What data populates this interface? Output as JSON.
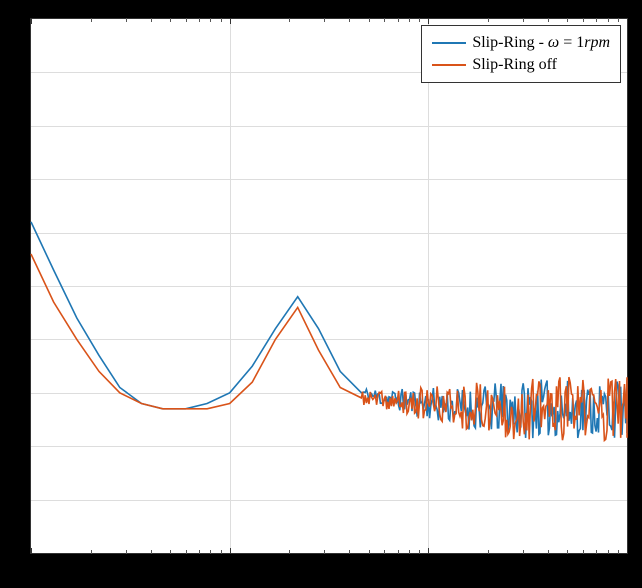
{
  "chart_data": {
    "type": "line",
    "x_scale": "log",
    "xlim": [
      1,
      1000
    ],
    "ylim": [
      0,
      1
    ],
    "grid_major_x": [
      1,
      10,
      100,
      1000
    ],
    "grid_major_y": [
      0,
      0.1,
      0.2,
      0.3,
      0.4,
      0.5,
      0.6,
      0.7,
      0.8,
      0.9,
      1.0
    ],
    "legend": {
      "position": "upper right",
      "entries": [
        {
          "name": "Slip-Ring - ω = 1rpm",
          "color": "#1f77b4"
        },
        {
          "name": "Slip-Ring off",
          "color": "#d95319"
        }
      ]
    },
    "series": [
      {
        "name": "Slip-Ring - ω = 1rpm",
        "color": "#1f77b4",
        "x": [
          1,
          1.3,
          1.7,
          2.2,
          2.8,
          3.6,
          4.6,
          6,
          7.7,
          10,
          13,
          17,
          22,
          28,
          36,
          46,
          60,
          77,
          100,
          130,
          170,
          220,
          280,
          360,
          460,
          600,
          770,
          1000
        ],
        "y": [
          0.62,
          0.53,
          0.44,
          0.37,
          0.31,
          0.28,
          0.27,
          0.27,
          0.28,
          0.3,
          0.35,
          0.42,
          0.48,
          0.42,
          0.34,
          0.3,
          0.29,
          0.285,
          0.28,
          0.275,
          0.27,
          0.27,
          0.27,
          0.27,
          0.27,
          0.27,
          0.27,
          0.27
        ],
        "noise_after_x": 46,
        "noise_amp": 0.055
      },
      {
        "name": "Slip-Ring off",
        "color": "#d95319",
        "x": [
          1,
          1.3,
          1.7,
          2.2,
          2.8,
          3.6,
          4.6,
          6,
          7.7,
          10,
          13,
          17,
          22,
          28,
          36,
          46,
          60,
          77,
          100,
          130,
          170,
          220,
          280,
          360,
          460,
          600,
          770,
          1000
        ],
        "y": [
          0.56,
          0.47,
          0.4,
          0.34,
          0.3,
          0.28,
          0.27,
          0.27,
          0.27,
          0.28,
          0.32,
          0.4,
          0.46,
          0.38,
          0.31,
          0.29,
          0.285,
          0.28,
          0.28,
          0.275,
          0.275,
          0.27,
          0.27,
          0.27,
          0.27,
          0.27,
          0.27,
          0.27
        ],
        "noise_after_x": 46,
        "noise_amp": 0.06
      }
    ]
  },
  "colors": {
    "series1": "#1f77b4",
    "series2": "#d95319"
  },
  "legend_labels": {
    "s1_pre": "Slip-Ring - ",
    "s1_omega": "ω",
    "s1_eq": " = 1",
    "s1_unit": "rpm",
    "s2": "Slip-Ring off"
  }
}
